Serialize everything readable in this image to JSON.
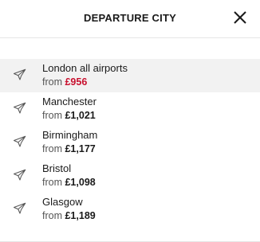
{
  "header": {
    "title": "DEPARTURE CITY",
    "close_icon": "close-icon"
  },
  "cities": [
    {
      "name": "London all airports",
      "from_label": "from",
      "price": "£956",
      "highlighted": true
    },
    {
      "name": "Manchester",
      "from_label": "from",
      "price": "£1,021",
      "highlighted": false
    },
    {
      "name": "Birmingham",
      "from_label": "from",
      "price": "£1,177",
      "highlighted": false
    },
    {
      "name": "Bristol",
      "from_label": "from",
      "price": "£1,098",
      "highlighted": false
    },
    {
      "name": "Glasgow",
      "from_label": "from",
      "price": "£1,189",
      "highlighted": false
    }
  ],
  "item_icon": "plane-icon",
  "colors": {
    "highlight_price": "#c8102e",
    "highlight_row_bg": "#f2f2f2",
    "text": "#1a1a1a"
  }
}
